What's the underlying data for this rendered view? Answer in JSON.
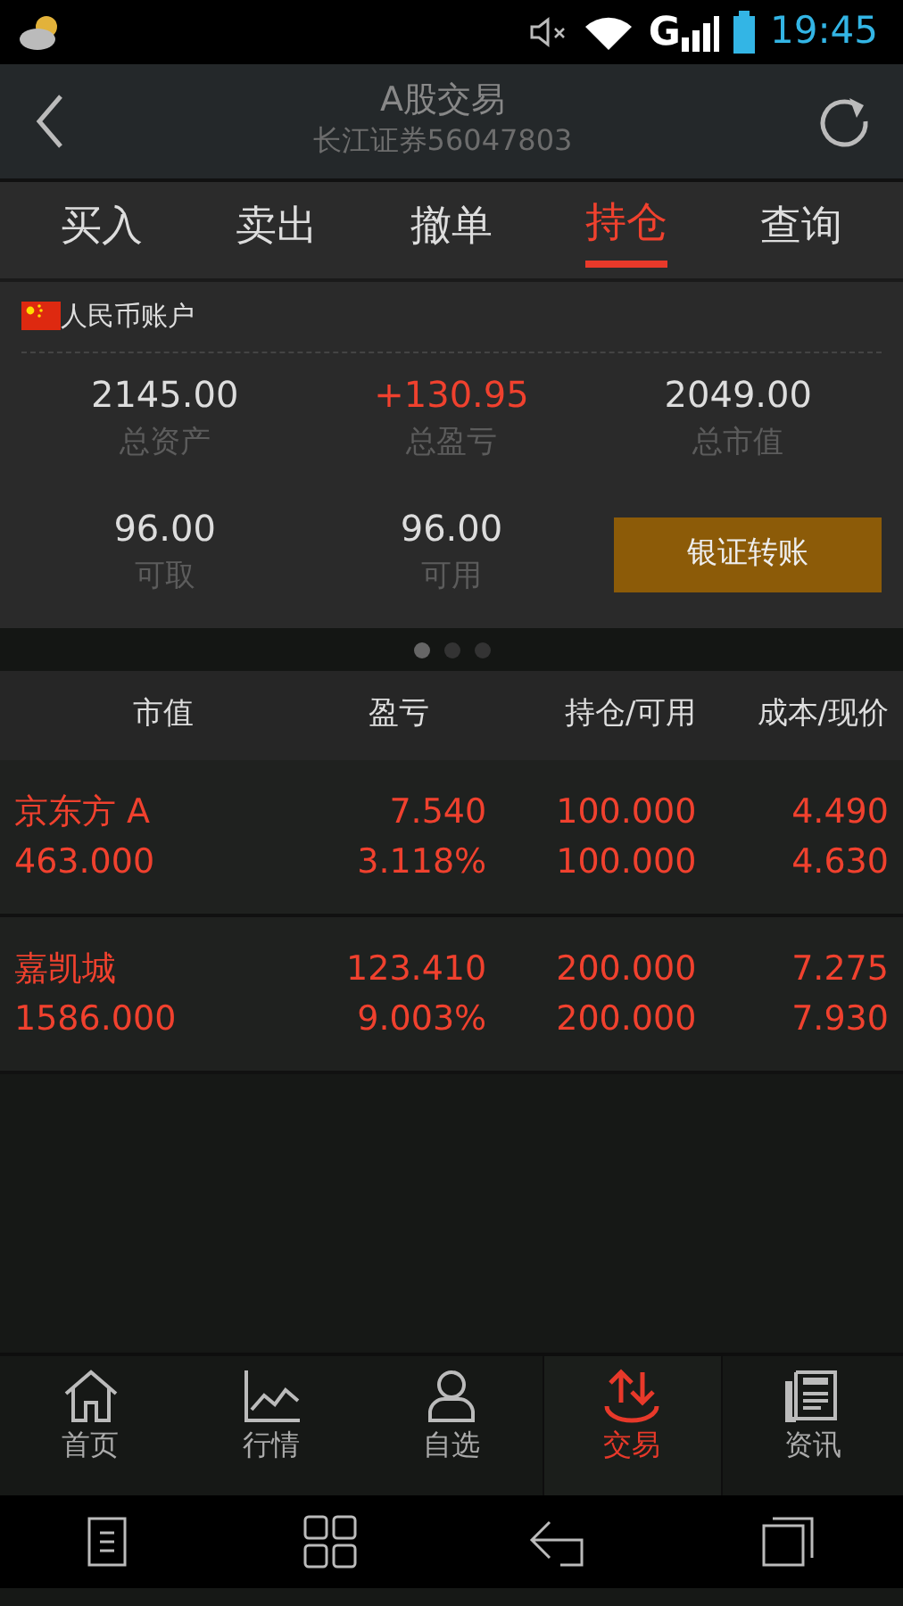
{
  "status_bar": {
    "network": "G",
    "time": "19:45"
  },
  "header": {
    "title": "A股交易",
    "subtitle": "长江证券56047803"
  },
  "tabs": [
    {
      "label": "买入",
      "selected": false
    },
    {
      "label": "卖出",
      "selected": false
    },
    {
      "label": "撤单",
      "selected": false
    },
    {
      "label": "持仓",
      "selected": true
    },
    {
      "label": "查询",
      "selected": false
    }
  ],
  "account": {
    "label": "人民币账户",
    "stats": [
      {
        "value": "2145.00",
        "label": "总资产",
        "kind": "plain"
      },
      {
        "value": "+130.95",
        "label": "总盈亏",
        "kind": "gain"
      },
      {
        "value": "2049.00",
        "label": "总市值",
        "kind": "plain"
      },
      {
        "value": "96.00",
        "label": "可取",
        "kind": "plain"
      },
      {
        "value": "96.00",
        "label": "可用",
        "kind": "plain"
      }
    ],
    "transfer_button": "银证转账"
  },
  "pager": [
    {
      "selected": true
    },
    {
      "selected": false
    },
    {
      "selected": false
    }
  ],
  "table": {
    "columns": [
      "市值",
      "盈亏",
      "持仓/可用",
      "成本/现价"
    ],
    "rows": [
      {
        "kind": "gain",
        "name": "京东方 A",
        "market_value": "463.000",
        "profit": "7.540",
        "profit_pct": "3.118%",
        "holding": "100.000",
        "available": "100.000",
        "cost": "4.490",
        "price": "4.630"
      },
      {
        "kind": "gain",
        "name": "嘉凯城",
        "market_value": "1586.000",
        "profit": "123.410",
        "profit_pct": "9.003%",
        "holding": "200.000",
        "available": "200.000",
        "cost": "7.275",
        "price": "7.930"
      }
    ]
  },
  "bottom_nav": [
    {
      "label": "首页",
      "kind": "home",
      "selected": false
    },
    {
      "label": "行情",
      "kind": "chart",
      "selected": false
    },
    {
      "label": "自选",
      "kind": "person",
      "selected": false
    },
    {
      "label": "交易",
      "kind": "trade",
      "selected": true
    },
    {
      "label": "资讯",
      "kind": "news",
      "selected": false
    }
  ]
}
